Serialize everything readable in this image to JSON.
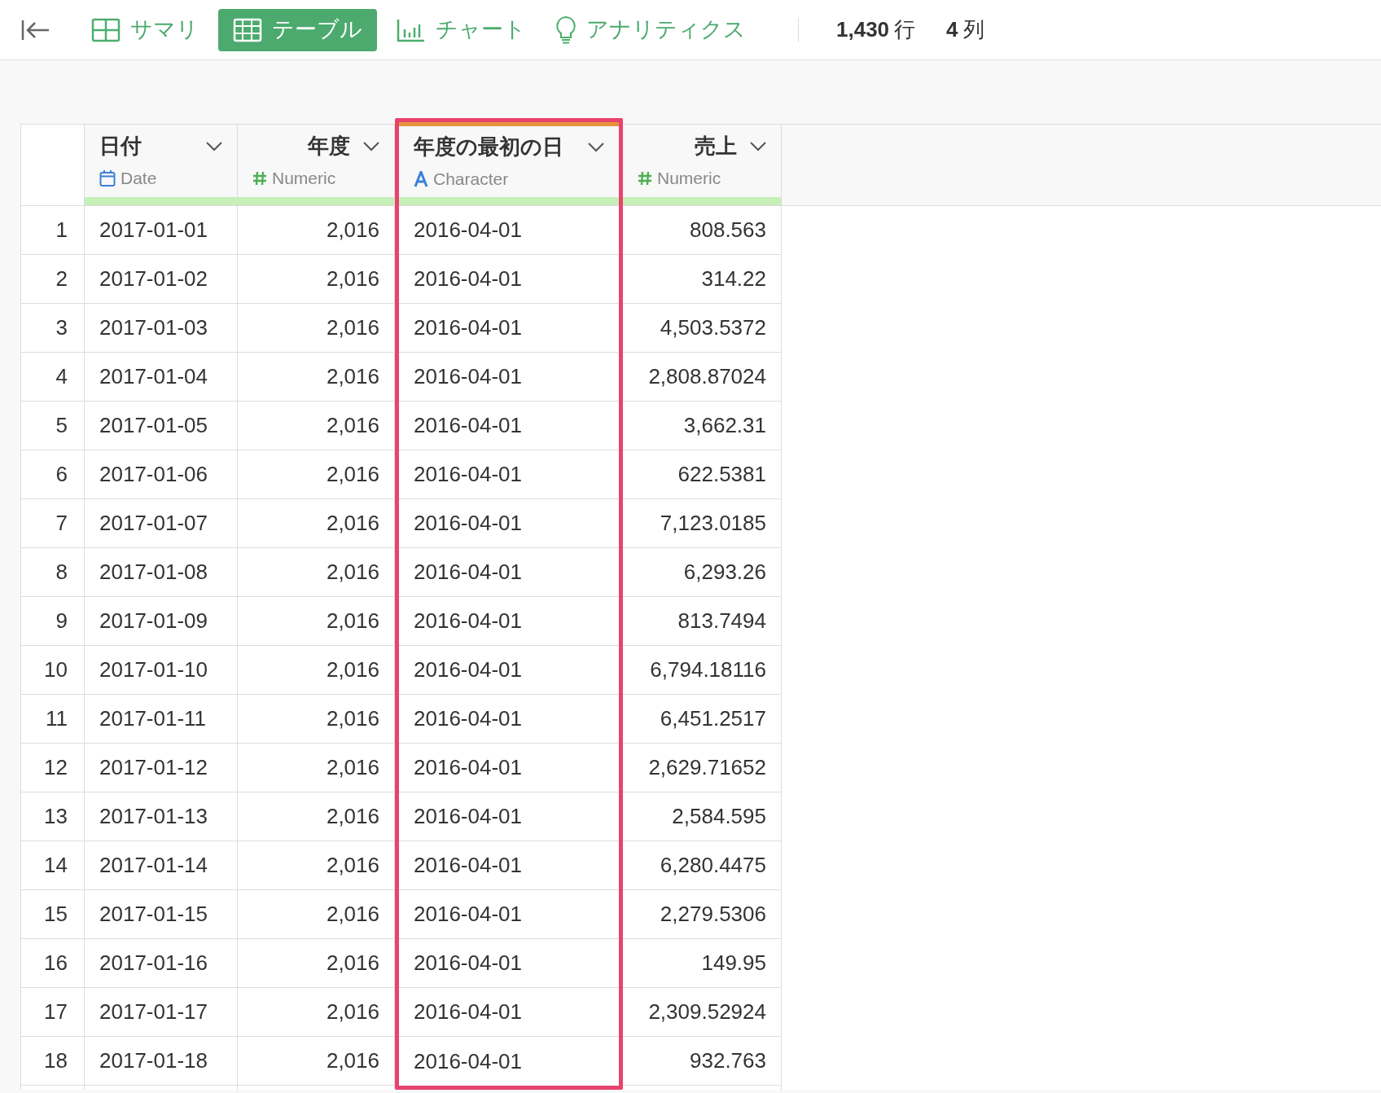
{
  "toolbar": {
    "tabs": [
      {
        "kind": "summary",
        "label": "サマリ",
        "selected": false
      },
      {
        "kind": "table",
        "label": "テーブル",
        "selected": true
      },
      {
        "kind": "chart",
        "label": "チャート",
        "selected": false
      },
      {
        "kind": "analytics",
        "label": "アナリティクス",
        "selected": false
      }
    ],
    "row_count": "1,430",
    "row_unit": "行",
    "column_count": "4",
    "column_unit": "列"
  },
  "table": {
    "columns": [
      {
        "name": "日付",
        "kind": "date",
        "type_label": "Date",
        "selected": false
      },
      {
        "name": "年度",
        "kind": "numeric",
        "type_label": "Numeric",
        "selected": false
      },
      {
        "name": "年度の最初の日",
        "kind": "character",
        "type_label": "Character",
        "selected": true
      },
      {
        "name": "売上",
        "kind": "numeric",
        "type_label": "Numeric",
        "selected": false
      }
    ],
    "rows": [
      {
        "number": "1",
        "cells": [
          "2017-01-01",
          "2,016",
          "2016-04-01",
          "808.563"
        ]
      },
      {
        "number": "2",
        "cells": [
          "2017-01-02",
          "2,016",
          "2016-04-01",
          "314.22"
        ]
      },
      {
        "number": "3",
        "cells": [
          "2017-01-03",
          "2,016",
          "2016-04-01",
          "4,503.5372"
        ]
      },
      {
        "number": "4",
        "cells": [
          "2017-01-04",
          "2,016",
          "2016-04-01",
          "2,808.87024"
        ]
      },
      {
        "number": "5",
        "cells": [
          "2017-01-05",
          "2,016",
          "2016-04-01",
          "3,662.31"
        ]
      },
      {
        "number": "6",
        "cells": [
          "2017-01-06",
          "2,016",
          "2016-04-01",
          "622.5381"
        ]
      },
      {
        "number": "7",
        "cells": [
          "2017-01-07",
          "2,016",
          "2016-04-01",
          "7,123.0185"
        ]
      },
      {
        "number": "8",
        "cells": [
          "2017-01-08",
          "2,016",
          "2016-04-01",
          "6,293.26"
        ]
      },
      {
        "number": "9",
        "cells": [
          "2017-01-09",
          "2,016",
          "2016-04-01",
          "813.7494"
        ]
      },
      {
        "number": "10",
        "cells": [
          "2017-01-10",
          "2,016",
          "2016-04-01",
          "6,794.18116"
        ]
      },
      {
        "number": "11",
        "cells": [
          "2017-01-11",
          "2,016",
          "2016-04-01",
          "6,451.2517"
        ]
      },
      {
        "number": "12",
        "cells": [
          "2017-01-12",
          "2,016",
          "2016-04-01",
          "2,629.71652"
        ]
      },
      {
        "number": "13",
        "cells": [
          "2017-01-13",
          "2,016",
          "2016-04-01",
          "2,584.595"
        ]
      },
      {
        "number": "14",
        "cells": [
          "2017-01-14",
          "2,016",
          "2016-04-01",
          "6,280.4475"
        ]
      },
      {
        "number": "15",
        "cells": [
          "2017-01-15",
          "2,016",
          "2016-04-01",
          "2,279.5306"
        ]
      },
      {
        "number": "16",
        "cells": [
          "2017-01-16",
          "2,016",
          "2016-04-01",
          "149.95"
        ]
      },
      {
        "number": "17",
        "cells": [
          "2017-01-17",
          "2,016",
          "2016-04-01",
          "2,309.52924"
        ]
      },
      {
        "number": "18",
        "cells": [
          "2017-01-18",
          "2,016",
          "2016-04-01",
          "932.763"
        ]
      }
    ]
  }
}
